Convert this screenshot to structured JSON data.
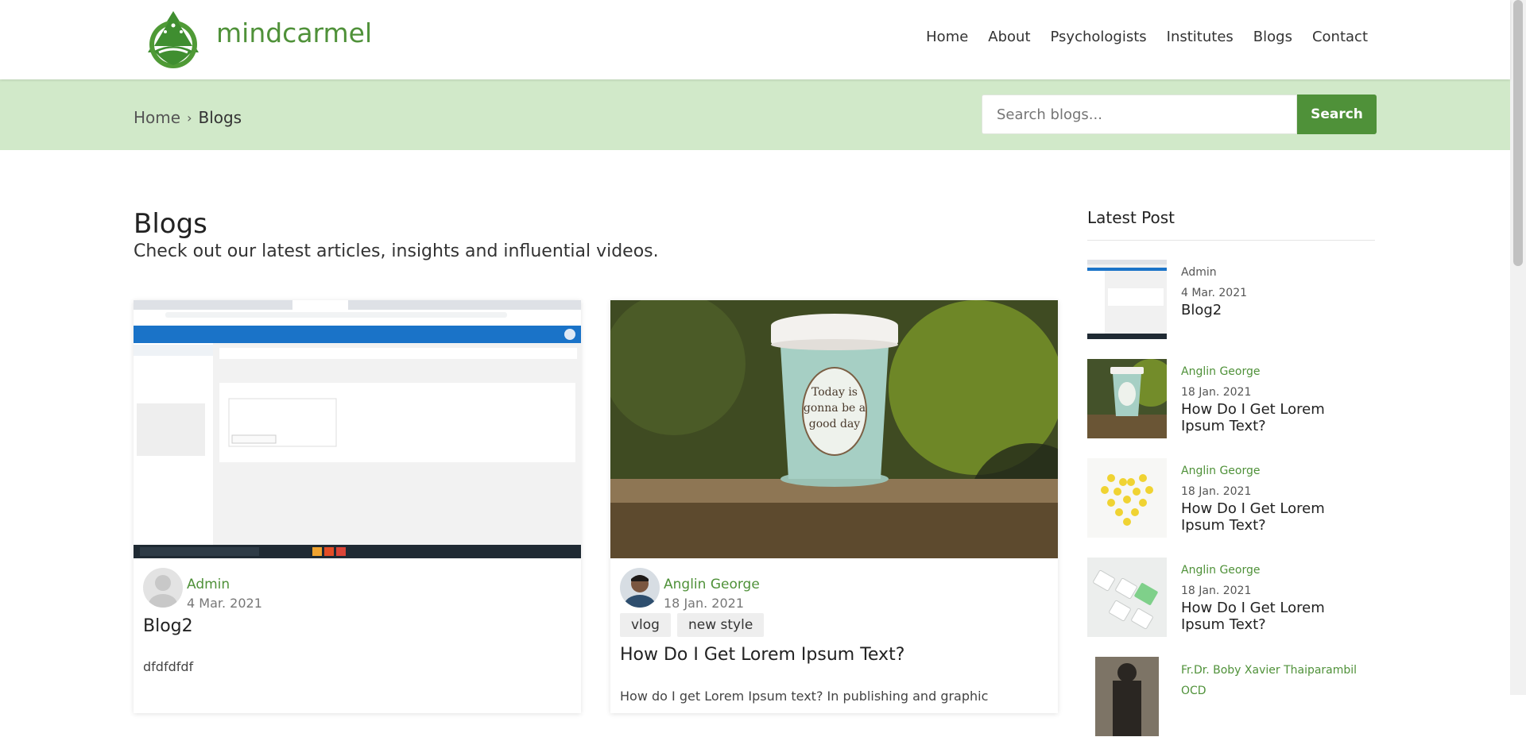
{
  "header": {
    "brand": "mindcarmel",
    "nav": [
      "Home",
      "About",
      "Psychologists",
      "Institutes",
      "Blogs",
      "Contact"
    ]
  },
  "breadcrumb": {
    "home": "Home",
    "separator": "›",
    "current": "Blogs"
  },
  "search": {
    "placeholder": "Search blogs...",
    "button": "Search"
  },
  "main": {
    "title": "Blogs",
    "subtitle": "Check out our latest articles, insights and influential videos."
  },
  "cards": [
    {
      "author": "Admin",
      "date": "4 Mar. 2021",
      "title": "Blog2",
      "excerpt": "dfdfdfdf",
      "tags": []
    },
    {
      "author": "Anglin George",
      "date": "18 Jan. 2021",
      "title": "How Do I Get Lorem Ipsum Text?",
      "excerpt": "How do I get Lorem Ipsum text? In publishing and graphic",
      "tags": [
        "vlog",
        "new style"
      ]
    }
  ],
  "sidebar": {
    "title": "Latest Post",
    "posts": [
      {
        "author": "Admin",
        "date": "4 Mar. 2021",
        "title": "Blog2"
      },
      {
        "author": "Anglin George",
        "date": "18 Jan. 2021",
        "title": "How Do I Get Lorem Ipsum Text?"
      },
      {
        "author": "Anglin George",
        "date": "18 Jan. 2021",
        "title": "How Do I Get Lorem Ipsum Text?"
      },
      {
        "author": "Anglin George",
        "date": "18 Jan. 2021",
        "title": "How Do I Get Lorem Ipsum Text?"
      },
      {
        "author": "Fr.Dr. Boby Xavier Thaiparambil OCD"
      }
    ]
  },
  "colors": {
    "brand_green": "#4f9139",
    "band_green": "#d1e9c9"
  }
}
